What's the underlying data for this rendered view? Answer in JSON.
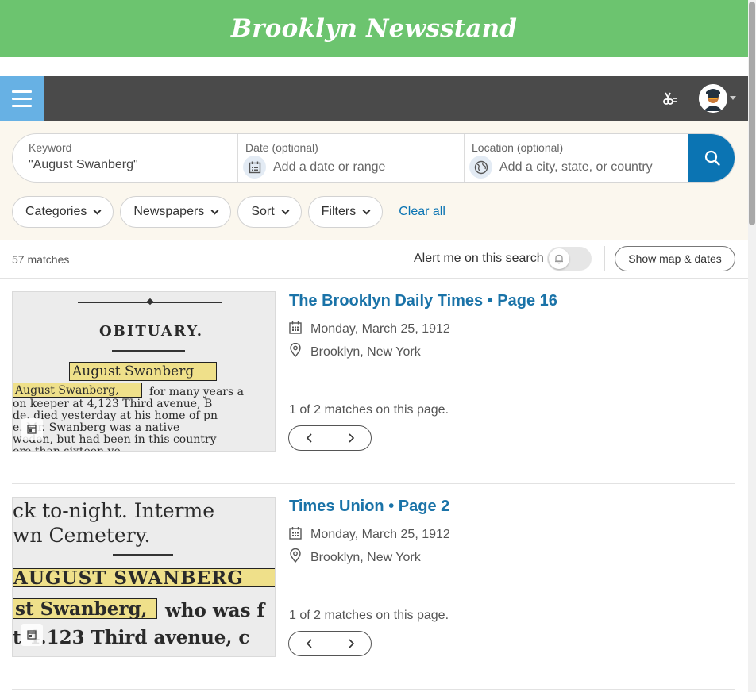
{
  "brand": {
    "title": "Brooklyn Newsstand"
  },
  "colors": {
    "brand_green": "#6cc46f",
    "nav_dark": "#4a4a4a",
    "menu_blue": "#67b1e4",
    "accent_blue": "#0b74b3",
    "search_bg": "#fbf7ee",
    "highlight": "#efe08a"
  },
  "nav": {
    "menu_icon": "hamburger-icon",
    "clip_icon": "scissors-icon",
    "avatar_icon": "user-avatar-icon"
  },
  "search": {
    "keyword_label": "Keyword",
    "keyword_value": "\"August Swanberg\"",
    "date_label": "Date (optional)",
    "date_placeholder": "Add a date or range",
    "location_label": "Location (optional)",
    "location_placeholder": "Add a city, state, or country",
    "submit_icon": "search-icon"
  },
  "filters": {
    "categories": "Categories",
    "newspapers": "Newspapers",
    "sort": "Sort",
    "filters": "Filters",
    "clear_all": "Clear all"
  },
  "results_header": {
    "count": "57 matches",
    "alert_label": "Alert me on this search",
    "map_button": "Show map & dates"
  },
  "results": [
    {
      "title": "The Brooklyn Daily Times • Page 16",
      "date": "Monday, March 25, 1912",
      "location": "Brooklyn, New York",
      "match_info": "1 of 2 matches on this page.",
      "snippet": {
        "heading": "OBITUARY.",
        "highlight_1": "August Swanberg",
        "highlight_2": "August Swanberg,",
        "line_1_rest": "for many years a",
        "line_2": "on keeper at 4,123 Third avenue, B",
        "line_3": "de. died yesterday at his home of pn",
        "line_4": "e. Mr. Swanberg was a native",
        "line_5": "weden, but had been in this country",
        "line_6": "ore than sixteen ye"
      }
    },
    {
      "title": "Times Union • Page 2",
      "date": "Monday, March 25, 1912",
      "location": "Brooklyn, New York",
      "match_info": "1 of 2 matches on this page.",
      "snippet": {
        "line_1": "ck  to-night.   Interme",
        "line_2": "wn  Cemetery.",
        "highlight_1": "AUGUST SWANBERG",
        "highlight_2": "st Swanberg,",
        "line_3_rest": "who was f",
        "line_4": "t 4.123  Third  avenue,  c"
      }
    }
  ]
}
